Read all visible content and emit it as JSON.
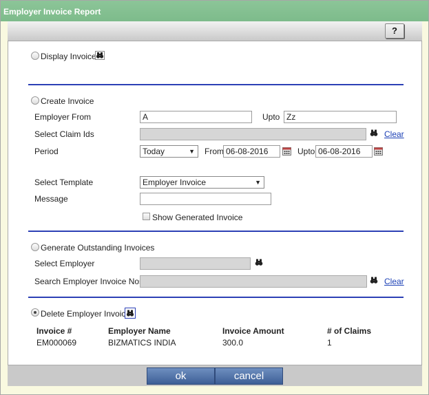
{
  "window": {
    "title": "Employer Invoice Report"
  },
  "toolbar": {
    "help_label": "?"
  },
  "display_invoice": {
    "label": "Display Invoice"
  },
  "create_invoice": {
    "label": "Create Invoice",
    "employer_from_label": "Employer From",
    "employer_from_value": "A",
    "upto_label": "Upto",
    "upto_value": "Zz",
    "claim_ids_label": "Select Claim Ids",
    "claim_ids_value": "",
    "clear_label": "Clear",
    "period_label": "Period",
    "period_value": "Today",
    "from_label": "From",
    "from_date": "06-08-2016",
    "period_upto_label": "Upto",
    "upto_date": "06-08-2016",
    "template_label": "Select Template",
    "template_value": "Employer Invoice",
    "message_label": "Message",
    "message_value": "",
    "show_generated_label": "Show Generated Invoice"
  },
  "outstanding": {
    "label": "Generate Outstanding Invoices",
    "select_employer_label": "Select Employer",
    "select_employer_value": "",
    "search_label": "Search Employer Invoice Nos",
    "search_value": "",
    "clear_label": "Clear"
  },
  "delete_invoice": {
    "label": "Delete Employer Invoice",
    "columns": [
      "Invoice #",
      "Employer Name",
      "Invoice Amount",
      "# of Claims"
    ],
    "rows": [
      [
        "EM000069",
        "BIZMATICS INDIA",
        "300.0",
        "1"
      ]
    ]
  },
  "footer": {
    "ok_label": "ok",
    "cancel_label": "cancel"
  },
  "colors": {
    "title_bar": "#7dbb8b",
    "separator": "#2b3fb5",
    "button": "#4d6fa6"
  }
}
